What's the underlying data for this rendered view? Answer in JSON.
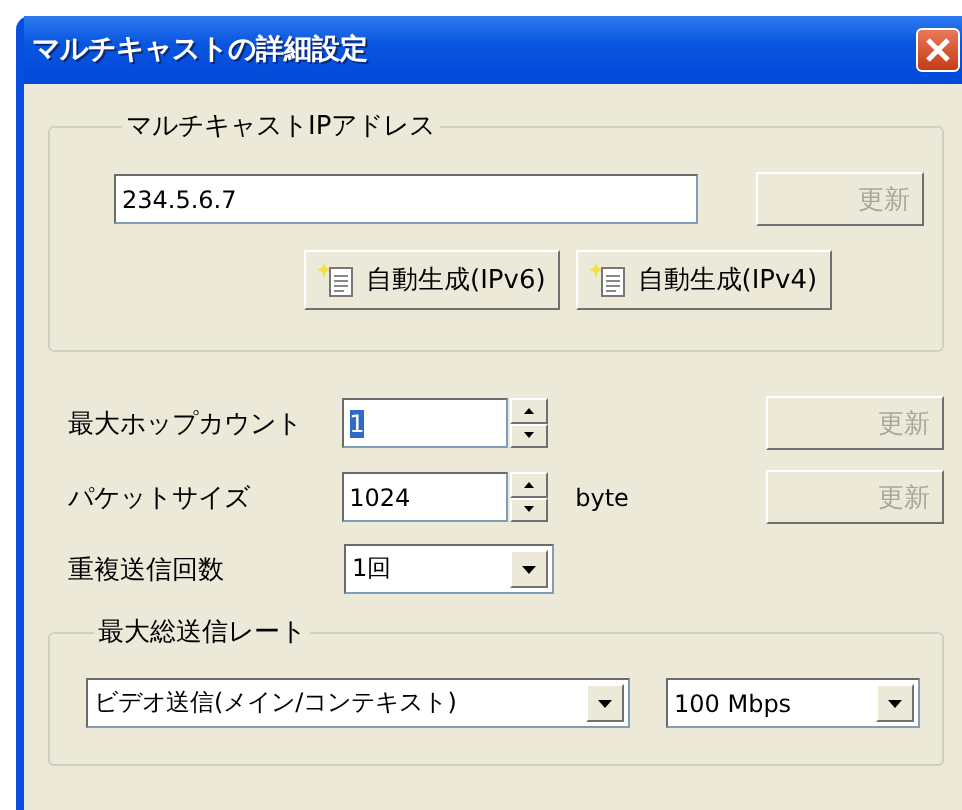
{
  "window": {
    "title": "マルチキャストの詳細設定"
  },
  "address_group": {
    "title": "マルチキャストIPアドレス",
    "address": "234.5.6.7",
    "update_button": {
      "label": "更新",
      "disabled": true
    },
    "generate_buttons": [
      {
        "label": "自動生成(IPv6)"
      },
      {
        "label": "自動生成(IPv4)"
      }
    ]
  },
  "settings": [
    {
      "kind": "spin",
      "label": "最大ホップカウント",
      "value": "1",
      "value_selected": true,
      "update_button": {
        "label": "更新",
        "disabled": true
      }
    },
    {
      "kind": "spin",
      "label": "パケットサイズ",
      "value": "1024",
      "value_selected": false,
      "unit": "byte",
      "update_button": {
        "label": "更新",
        "disabled": true
      }
    },
    {
      "kind": "combo",
      "label": "重複送信回数",
      "value": "1回"
    }
  ],
  "rate_group": {
    "title": "最大総送信レート",
    "stream": "ビデオ送信(メイン/コンテキスト)",
    "rate": "100 Mbps"
  }
}
